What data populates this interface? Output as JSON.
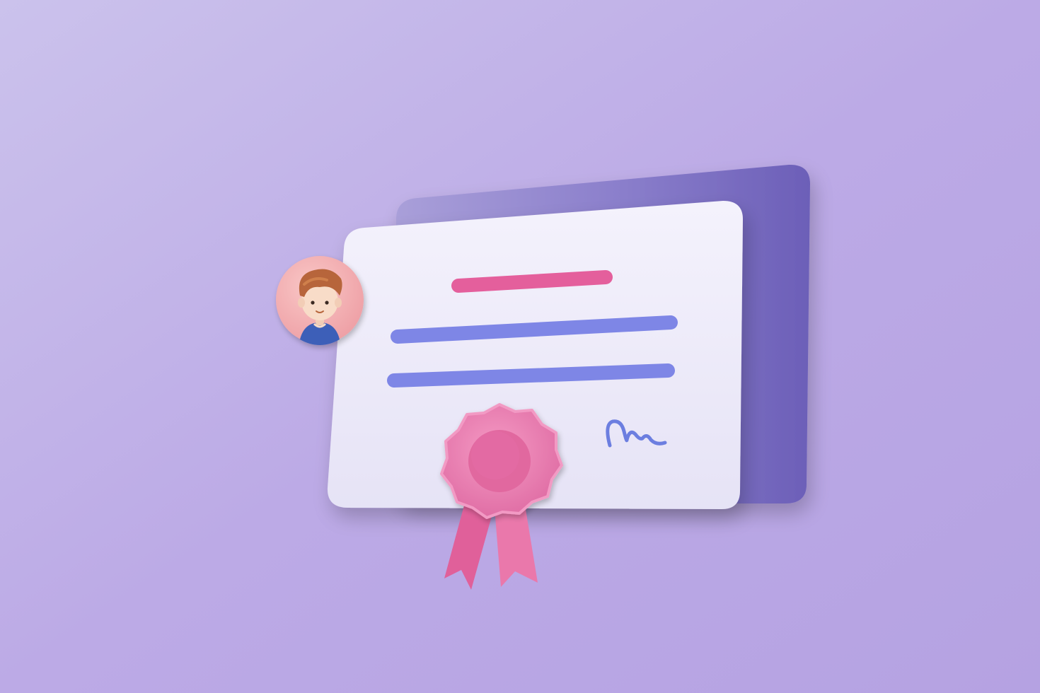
{
  "scene": {
    "subject": "certificate-illustration",
    "colors": {
      "background_light": "#cbc2ec",
      "background_mid": "#bcaae6",
      "background_dark": "#b5a2e2",
      "back_card": "#7d71c4",
      "back_card_dark": "#6c5fb8",
      "front_card": "#f0eefa",
      "title_bar": "#e45f9c",
      "text_line": "#7e86e6",
      "seal": "#ee7fb4",
      "seal_center": "#e1679f",
      "ribbon": "#e8679e",
      "signature": "#6c7ee0",
      "avatar_bg": "#f4b9bb",
      "avatar_hair": "#b7653a",
      "avatar_skin": "#f8dcc8",
      "avatar_shirt": "#3d5fb8"
    },
    "icons": {
      "avatar": "person-avatar-icon",
      "seal": "award-rosette-icon",
      "signature": "signature-icon"
    }
  }
}
